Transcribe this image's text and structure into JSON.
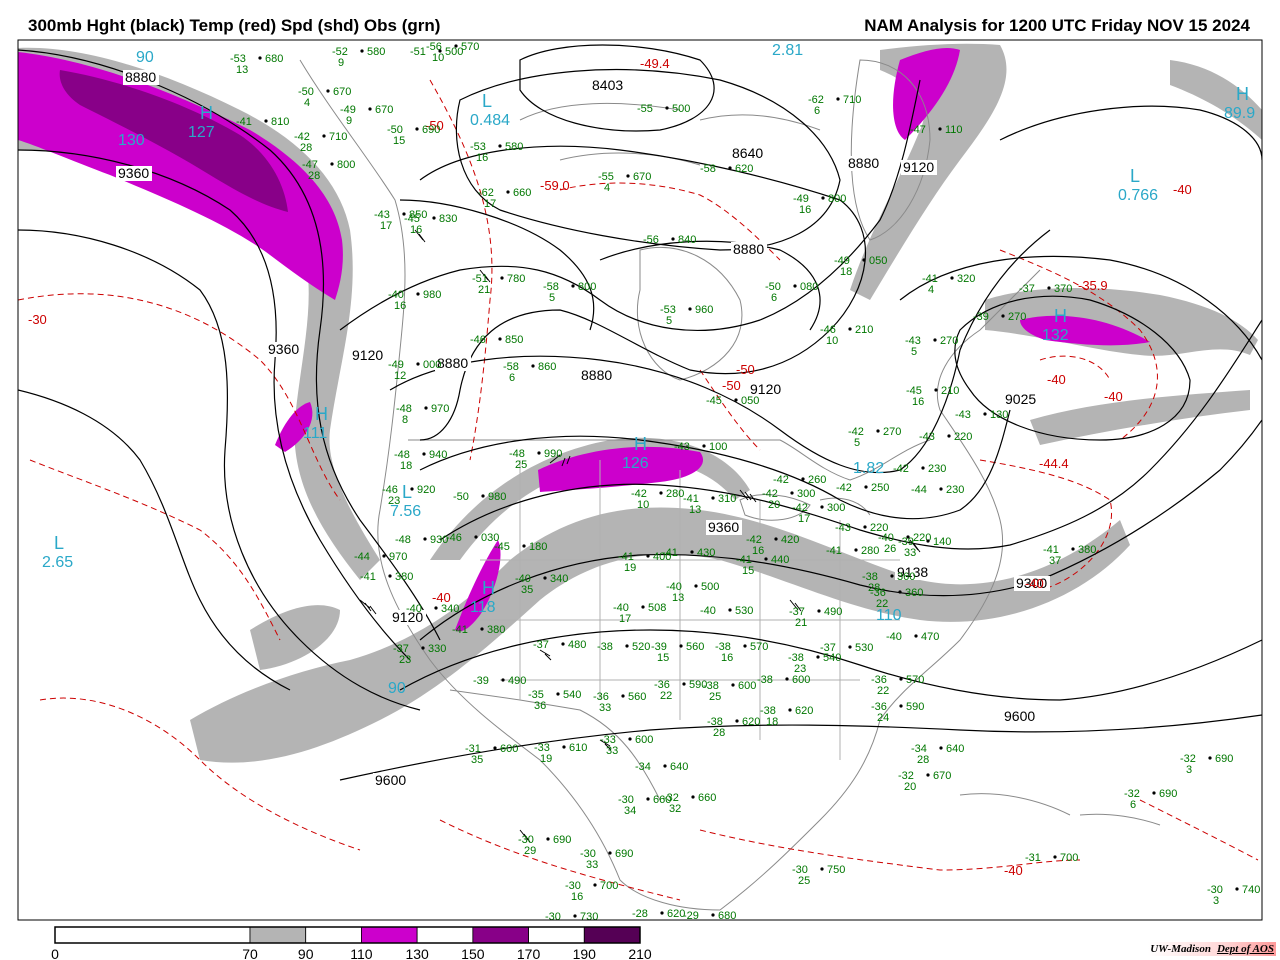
{
  "header": {
    "left_title": "300mb Hght (black) Temp (red) Spd (shd) Obs (grn)",
    "right_title": "NAM Analysis for 1200 UTC Friday  NOV 15 2024"
  },
  "colors": {
    "height_contours": "#000000",
    "temp_contours": "#cc0000",
    "obs": "#007700",
    "centers": "#2aa8c8",
    "speed_70": "#b4b4b4",
    "speed_110": "#cc00cc",
    "speed_150": "#880088",
    "speed_190": "#550055",
    "boundaries": "#8a8a8a"
  },
  "legend": {
    "bins": [
      {
        "from": 0,
        "to": 70,
        "color": "#ffffff"
      },
      {
        "from": 70,
        "to": 90,
        "color": "#b4b4b4"
      },
      {
        "from": 90,
        "to": 110,
        "color": "#ffffff"
      },
      {
        "from": 110,
        "to": 130,
        "color": "#cc00cc"
      },
      {
        "from": 130,
        "to": 150,
        "color": "#ffffff"
      },
      {
        "from": 150,
        "to": 170,
        "color": "#880088"
      },
      {
        "from": 170,
        "to": 190,
        "color": "#ffffff"
      },
      {
        "from": 190,
        "to": 210,
        "color": "#550055"
      }
    ],
    "ticks": [
      "0",
      "70",
      "90",
      "110",
      "130",
      "150",
      "170",
      "190",
      "210"
    ]
  },
  "height_labels": [
    "8880",
    "9360",
    "8403",
    "8640",
    "8880",
    "9120",
    "8880",
    "9360",
    "9120",
    "8880",
    "8880",
    "9120",
    "9025",
    "9360",
    "9138",
    "9300",
    "9120",
    "9600",
    "9600"
  ],
  "temp_labels": [
    "-50",
    "-59.0",
    "-49.4",
    "-50",
    "-50",
    "-40",
    "-35.9",
    "-40",
    "-40",
    "-44.4",
    "-40",
    "-40",
    "-30",
    "-40"
  ],
  "center_labels": [
    {
      "mark": "L",
      "value": "0.484"
    },
    {
      "mark": "",
      "value": "2.81"
    },
    {
      "mark": "H",
      "value": "89.9"
    },
    {
      "mark": "L",
      "value": "0.766"
    },
    {
      "mark": "L",
      "value": "2.65"
    },
    {
      "mark": "L",
      "value": "7.56"
    },
    {
      "mark": "H",
      "value": "126"
    },
    {
      "mark": "H",
      "value": "118"
    },
    {
      "mark": "H",
      "value": "132"
    },
    {
      "mark": "",
      "value": "1.82"
    },
    {
      "mark": "H",
      "value": "127"
    },
    {
      "mark": "",
      "value": "130"
    },
    {
      "mark": "H",
      "value": "111"
    },
    {
      "mark": "",
      "value": "90"
    },
    {
      "mark": "",
      "value": "110"
    },
    {
      "mark": "",
      "value": "90"
    }
  ],
  "center_marks": [
    "H",
    "L"
  ],
  "observations": [
    {
      "temp": "-53",
      "hgt": "680",
      "spd": "13"
    },
    {
      "temp": "-52",
      "hgt": "580",
      "spd": "9"
    },
    {
      "temp": "-56",
      "hgt": "570",
      "spd": "10"
    },
    {
      "temp": "-50",
      "hgt": "670",
      "spd": "4"
    },
    {
      "temp": "-49",
      "hgt": "670",
      "spd": "9"
    },
    {
      "temp": "-41",
      "hgt": "810",
      "spd": ""
    },
    {
      "temp": "-42",
      "hgt": "710",
      "spd": "28"
    },
    {
      "temp": "-50",
      "hgt": "690",
      "spd": "15"
    },
    {
      "temp": "-53",
      "hgt": "580",
      "spd": "16"
    },
    {
      "temp": "-51",
      "hgt": "500",
      "spd": ""
    },
    {
      "temp": "-55",
      "hgt": "500",
      "spd": ""
    },
    {
      "temp": "-62",
      "hgt": "710",
      "spd": "6"
    },
    {
      "temp": "-47",
      "hgt": "800",
      "spd": "28"
    },
    {
      "temp": "-55",
      "hgt": "670",
      "spd": "4"
    },
    {
      "temp": "-58",
      "hgt": "620",
      "spd": ""
    },
    {
      "temp": "-62",
      "hgt": "660",
      "spd": "17"
    },
    {
      "temp": "-49",
      "hgt": "800",
      "spd": "16"
    },
    {
      "temp": "-43",
      "hgt": "850",
      "spd": "17"
    },
    {
      "temp": "-45",
      "hgt": "830",
      "spd": "16"
    },
    {
      "temp": "-56",
      "hgt": "840",
      "spd": ""
    },
    {
      "temp": "-47",
      "hgt": "110",
      "spd": ""
    },
    {
      "temp": "-49",
      "hgt": "050",
      "spd": "18"
    },
    {
      "temp": "-51",
      "hgt": "780",
      "spd": "21"
    },
    {
      "temp": "-58",
      "hgt": "800",
      "spd": "5"
    },
    {
      "temp": "-50",
      "hgt": "080",
      "spd": "6"
    },
    {
      "temp": "-41",
      "hgt": "320",
      "spd": "4"
    },
    {
      "temp": "-40",
      "hgt": "980",
      "spd": "16"
    },
    {
      "temp": "-53",
      "hgt": "960",
      "spd": "5"
    },
    {
      "temp": "-46",
      "hgt": "210",
      "spd": "10"
    },
    {
      "temp": "-43",
      "hgt": "270",
      "spd": "5"
    },
    {
      "temp": "-46",
      "hgt": "850",
      "spd": ""
    },
    {
      "temp": "-49",
      "hgt": "000",
      "spd": "12"
    },
    {
      "temp": "-58",
      "hgt": "860",
      "spd": "6"
    },
    {
      "temp": "-37",
      "hgt": "370",
      "spd": ""
    },
    {
      "temp": "-39",
      "hgt": "270",
      "spd": ""
    },
    {
      "temp": "-45",
      "hgt": "210",
      "spd": "16"
    },
    {
      "temp": "-48",
      "hgt": "970",
      "spd": "8"
    },
    {
      "temp": "-45",
      "hgt": "050",
      "spd": ""
    },
    {
      "temp": "-43",
      "hgt": "130",
      "spd": ""
    },
    {
      "temp": "-42",
      "hgt": "270",
      "spd": "5"
    },
    {
      "temp": "-43",
      "hgt": "220",
      "spd": ""
    },
    {
      "temp": "-48",
      "hgt": "940",
      "spd": "18"
    },
    {
      "temp": "-48",
      "hgt": "990",
      "spd": "25"
    },
    {
      "temp": "-43",
      "hgt": "100",
      "spd": ""
    },
    {
      "temp": "-42",
      "hgt": "230",
      "spd": ""
    },
    {
      "temp": "-46",
      "hgt": "920",
      "spd": "23"
    },
    {
      "temp": "-50",
      "hgt": "980",
      "spd": ""
    },
    {
      "temp": "-42",
      "hgt": "280",
      "spd": "10"
    },
    {
      "temp": "-41",
      "hgt": "310",
      "spd": "13"
    },
    {
      "temp": "-42",
      "hgt": "300",
      "spd": "20"
    },
    {
      "temp": "-42",
      "hgt": "260",
      "spd": ""
    },
    {
      "temp": "-42",
      "hgt": "250",
      "spd": ""
    },
    {
      "temp": "-44",
      "hgt": "230",
      "spd": ""
    },
    {
      "temp": "-42",
      "hgt": "300",
      "spd": "17"
    },
    {
      "temp": "-43",
      "hgt": "220",
      "spd": ""
    },
    {
      "temp": "-41",
      "hgt": "280",
      "spd": ""
    },
    {
      "temp": "-40",
      "hgt": "220",
      "spd": "26"
    },
    {
      "temp": "-39",
      "hgt": "140",
      "spd": "33"
    },
    {
      "temp": "-48",
      "hgt": "930",
      "spd": ""
    },
    {
      "temp": "-46",
      "hgt": "030",
      "spd": ""
    },
    {
      "temp": "-44",
      "hgt": "970",
      "spd": ""
    },
    {
      "temp": "-45",
      "hgt": "180",
      "spd": ""
    },
    {
      "temp": "-42",
      "hgt": "420",
      "spd": "16"
    },
    {
      "temp": "-41",
      "hgt": "400",
      "spd": "19"
    },
    {
      "temp": "-41",
      "hgt": "430",
      "spd": ""
    },
    {
      "temp": "-41",
      "hgt": "440",
      "spd": "15"
    },
    {
      "temp": "-40",
      "hgt": "340",
      "spd": "35"
    },
    {
      "temp": "-38",
      "hgt": "360",
      "spd": "28"
    },
    {
      "temp": "-36",
      "hgt": "360",
      "spd": "22"
    },
    {
      "temp": "-41",
      "hgt": "380",
      "spd": ""
    },
    {
      "temp": "-40",
      "hgt": "340",
      "spd": ""
    },
    {
      "temp": "-40",
      "hgt": "508",
      "spd": "17"
    },
    {
      "temp": "-40",
      "hgt": "500",
      "spd": "13"
    },
    {
      "temp": "-40",
      "hgt": "530",
      "spd": ""
    },
    {
      "temp": "-37",
      "hgt": "490",
      "spd": "21"
    },
    {
      "temp": "-40",
      "hgt": "470",
      "spd": ""
    },
    {
      "temp": "-41",
      "hgt": "380",
      "spd": ""
    },
    {
      "temp": "-37",
      "hgt": "480",
      "spd": ""
    },
    {
      "temp": "-38",
      "hgt": "520",
      "spd": ""
    },
    {
      "temp": "-39",
      "hgt": "560",
      "spd": "15"
    },
    {
      "temp": "-38",
      "hgt": "570",
      "spd": "16"
    },
    {
      "temp": "-38",
      "hgt": "540",
      "spd": "23"
    },
    {
      "temp": "-37",
      "hgt": "530",
      "spd": ""
    },
    {
      "temp": "-36",
      "hgt": "570",
      "spd": "22"
    },
    {
      "temp": "-37",
      "hgt": "330",
      "spd": "23"
    },
    {
      "temp": "-39",
      "hgt": "490",
      "spd": ""
    },
    {
      "temp": "-35",
      "hgt": "540",
      "spd": "36"
    },
    {
      "temp": "-36",
      "hgt": "560",
      "spd": "33"
    },
    {
      "temp": "-36",
      "hgt": "590",
      "spd": "22"
    },
    {
      "temp": "-38",
      "hgt": "600",
      "spd": "25"
    },
    {
      "temp": "-38",
      "hgt": "600",
      "spd": ""
    },
    {
      "temp": "-36",
      "hgt": "590",
      "spd": "24"
    },
    {
      "temp": "-38",
      "hgt": "620",
      "spd": "28"
    },
    {
      "temp": "-38",
      "hgt": "620",
      "spd": "18"
    },
    {
      "temp": "-34",
      "hgt": "640",
      "spd": ""
    },
    {
      "temp": "-31",
      "hgt": "600",
      "spd": "35"
    },
    {
      "temp": "-33",
      "hgt": "610",
      "spd": "19"
    },
    {
      "temp": "-33",
      "hgt": "600",
      "spd": "33"
    },
    {
      "temp": "-34",
      "hgt": "640",
      "spd": "28"
    },
    {
      "temp": "-32",
      "hgt": "670",
      "spd": "20"
    },
    {
      "temp": "-32",
      "hgt": "690",
      "spd": "3"
    },
    {
      "temp": "-30",
      "hgt": "660",
      "spd": "34"
    },
    {
      "temp": "-32",
      "hgt": "660",
      "spd": "32"
    },
    {
      "temp": "-32",
      "hgt": "690",
      "spd": "6"
    },
    {
      "temp": "-30",
      "hgt": "690",
      "spd": "29"
    },
    {
      "temp": "-30",
      "hgt": "690",
      "spd": "33"
    },
    {
      "temp": "-30",
      "hgt": "700",
      "spd": "16"
    },
    {
      "temp": "-30",
      "hgt": "750",
      "spd": "25"
    },
    {
      "temp": "-31",
      "hgt": "700",
      "spd": ""
    },
    {
      "temp": "-30",
      "hgt": "730",
      "spd": ""
    },
    {
      "temp": "-28",
      "hgt": "620",
      "spd": ""
    },
    {
      "temp": "-29",
      "hgt": "680",
      "spd": ""
    },
    {
      "temp": "-30",
      "hgt": "740",
      "spd": "3"
    },
    {
      "temp": "-41",
      "hgt": "380",
      "spd": "37"
    }
  ],
  "credit": {
    "org": "UW-Madison",
    "dept": "Dept of AOS"
  }
}
